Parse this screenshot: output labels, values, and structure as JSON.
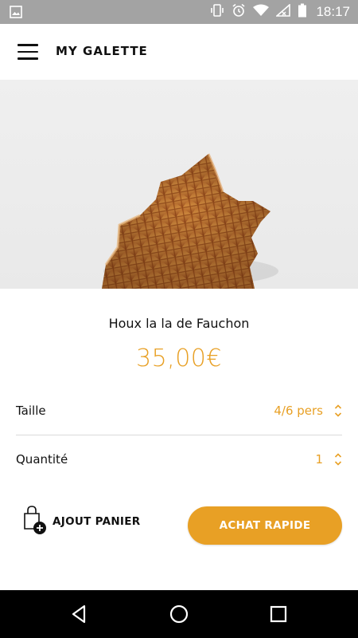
{
  "status_bar": {
    "time": "18:17",
    "icons": [
      "image-notification-icon",
      "vibrate-icon",
      "alarm-icon",
      "wifi-icon",
      "signal-icon",
      "battery-icon"
    ]
  },
  "app_bar": {
    "title": "MY GALETTE",
    "menu_icon": "hamburger-menu-icon"
  },
  "product": {
    "name": "Houx la la de Fauchon",
    "price": "35,00€",
    "image": "galette-des-rois-image"
  },
  "options": {
    "size": {
      "label": "Taille",
      "value": "4/6 pers"
    },
    "quantity": {
      "label": "Quantité",
      "value": "1"
    }
  },
  "actions": {
    "add_to_cart": "AJOUT PANIER",
    "quick_buy": "ACHAT RAPIDE"
  },
  "colors": {
    "accent": "#e8a025",
    "status_bar": "#a3a3a3",
    "nav_bar": "#000000",
    "text": "#111111"
  }
}
